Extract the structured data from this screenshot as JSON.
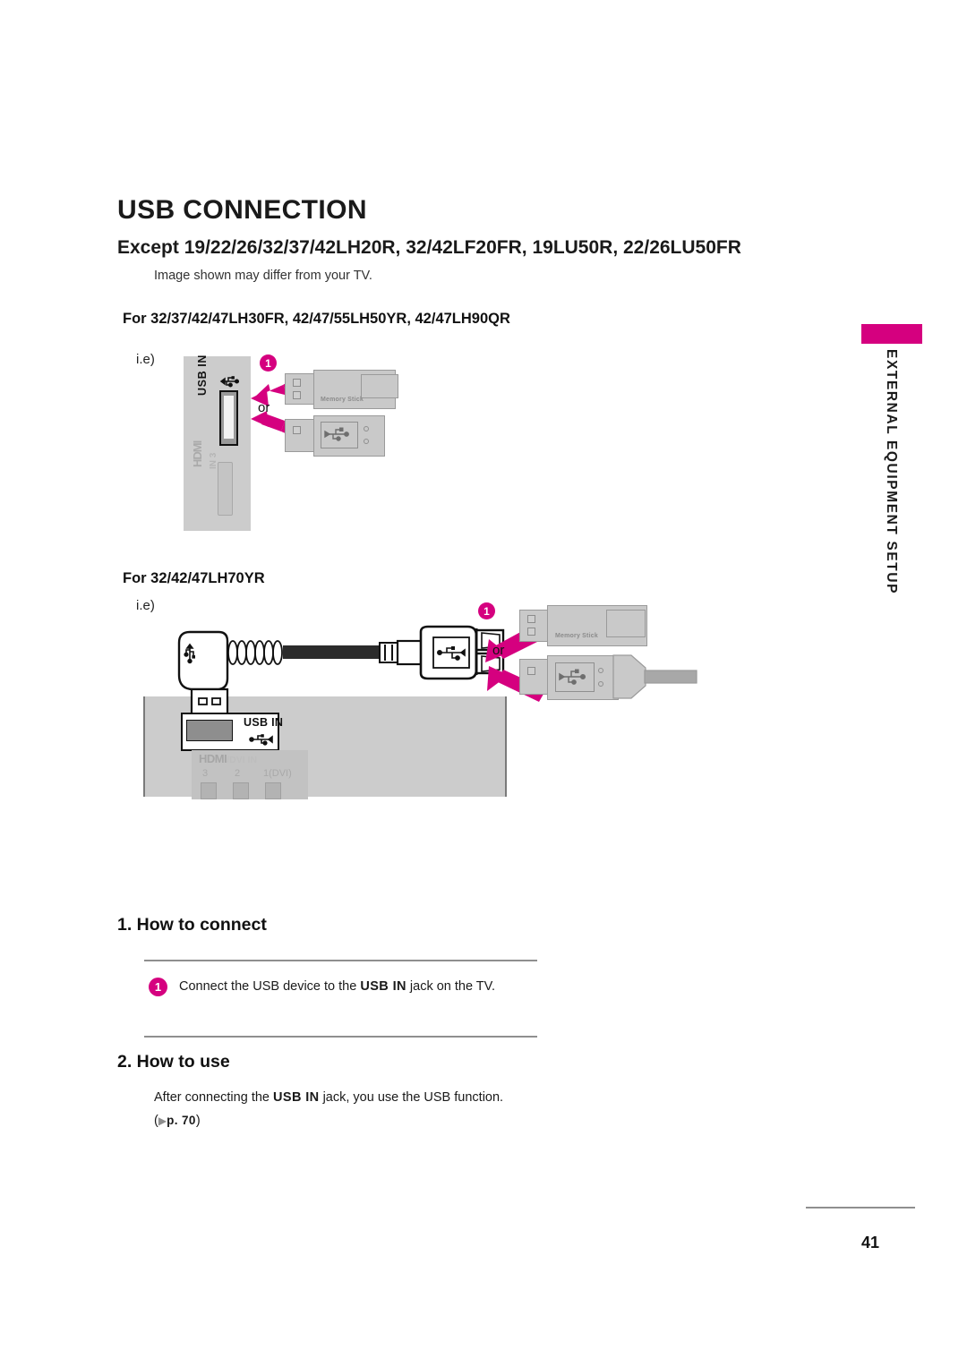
{
  "header": {
    "title": "USB CONNECTION",
    "subtitle_lead": "Except",
    "subtitle_models": "19/22/26/32/37/42LH20R, 32/42LF20FR, 19LU50R, 22/26LU50FR",
    "note": "Image shown may differ from your TV."
  },
  "sidebar": {
    "vertical_label": "EXTERNAL EQUIPMENT SETUP",
    "accent_color": "#D5007F"
  },
  "section_one": {
    "model_heading": "For 32/37/42/47LH30FR, 42/47/55LH50YR, 42/47LH90QR",
    "ie_label": "i.e)",
    "badge": "1",
    "or_label": "or",
    "port_label": "USB IN",
    "hdmi_label": "HDMI",
    "hdmi_number": "IN 3",
    "device_one_label": "Memory Stick"
  },
  "section_two": {
    "model_heading": "For 32/42/47LH70YR",
    "ie_label": "i.e)",
    "badge": "1",
    "or_label": "or",
    "port_label": "USB IN",
    "hdmi_label": "HDMI",
    "hdmi_suffix": "/DVI IN",
    "hdmi_ports": [
      "3",
      "2",
      "1(DVI)"
    ],
    "device_one_label": "Memory Stick"
  },
  "how_to_connect": {
    "heading": "1. How to connect",
    "step_badge": "1",
    "step_text_a": "Connect the USB device to the ",
    "step_text_bold": "USB IN",
    "step_text_b": " jack on the TV."
  },
  "how_to_use": {
    "heading": "2. How to use",
    "text_a": "After connecting the ",
    "text_bold": "USB IN",
    "text_b": " jack, you use the USB function.",
    "page_ref": "p. 70"
  },
  "footer": {
    "page_number": "41"
  }
}
